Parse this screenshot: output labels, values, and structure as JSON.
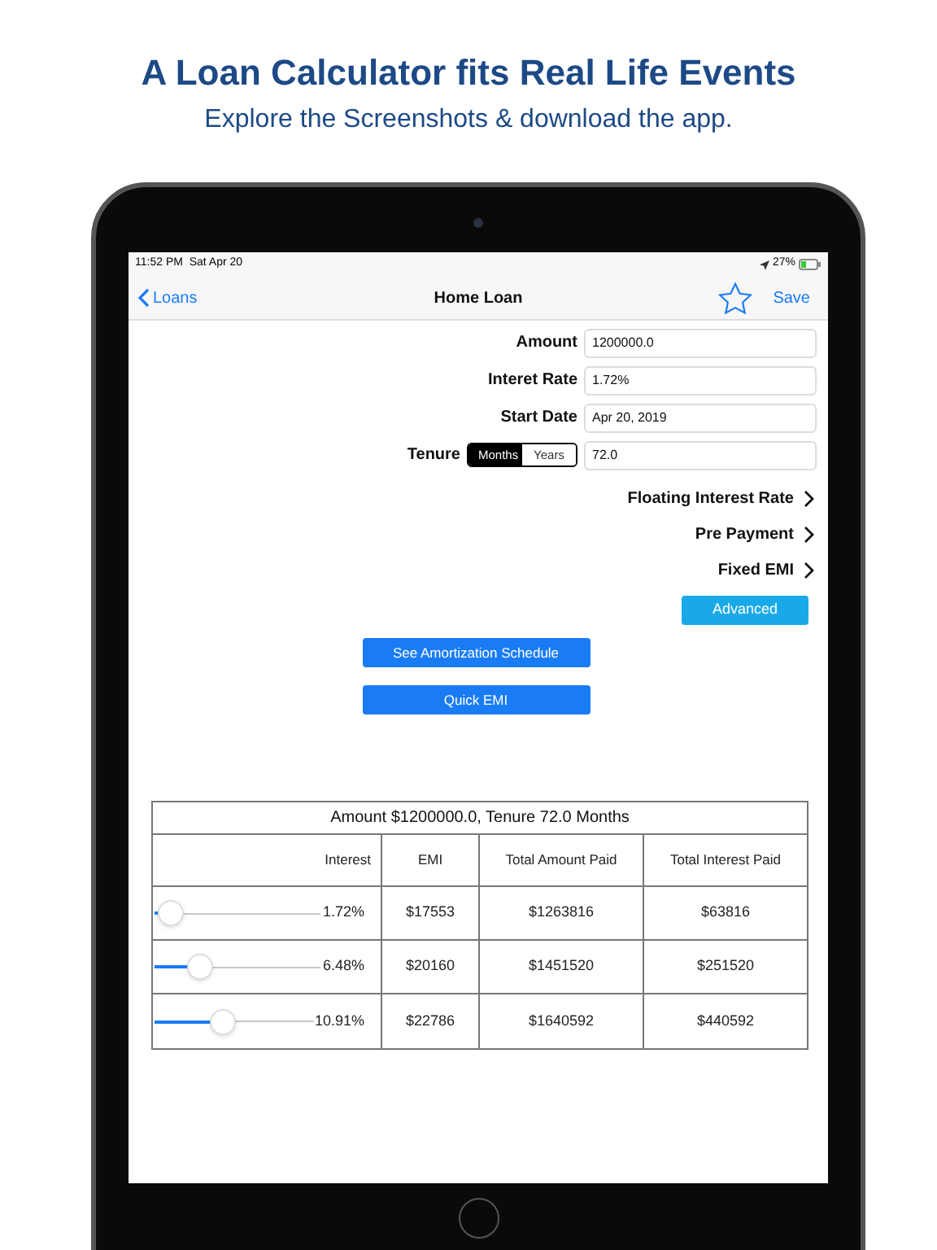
{
  "promo": {
    "title": "A Loan Calculator fits Real Life Events",
    "subtitle": "Explore the Screenshots & download the app."
  },
  "status_bar": {
    "time": "11:52 PM  Sat Apr 20",
    "battery": "27%"
  },
  "nav": {
    "back": "Loans",
    "title": "Home Loan",
    "save": "Save"
  },
  "form": [
    {
      "kind": "field",
      "label": "Amount",
      "value": "1200000.0"
    },
    {
      "kind": "field",
      "label": "Interet Rate",
      "value": "1.72%"
    },
    {
      "kind": "field",
      "label": "Start Date",
      "value": "Apr 20, 2019"
    },
    {
      "kind": "tenure",
      "label": "Tenure",
      "segments": [
        {
          "label": "Months",
          "selected": true
        },
        {
          "label": "Years",
          "selected": false
        }
      ],
      "value": "72.0"
    }
  ],
  "links": [
    "Floating Interest Rate",
    "Pre Payment",
    "Fixed EMI"
  ],
  "advanced_button": "Advanced",
  "buttons": [
    "See Amortization Schedule",
    "Quick EMI"
  ],
  "table": {
    "title": "Amount $1200000.0, Tenure 72.0 Months",
    "columns": [
      "Interest",
      "EMI",
      "Total Amount Paid",
      "Total Interest Paid"
    ],
    "rows": [
      {
        "level": 0.1,
        "interest": "1.72%",
        "emi": "$17553",
        "total_paid": "$1263816",
        "total_interest": "$63816"
      },
      {
        "level": 0.27,
        "interest": "6.48%",
        "emi": "$20160",
        "total_paid": "$1451520",
        "total_interest": "$251520"
      },
      {
        "level": 0.43,
        "interest": "10.91%",
        "emi": "$22786",
        "total_paid": "$1640592",
        "total_interest": "$440592"
      }
    ]
  }
}
